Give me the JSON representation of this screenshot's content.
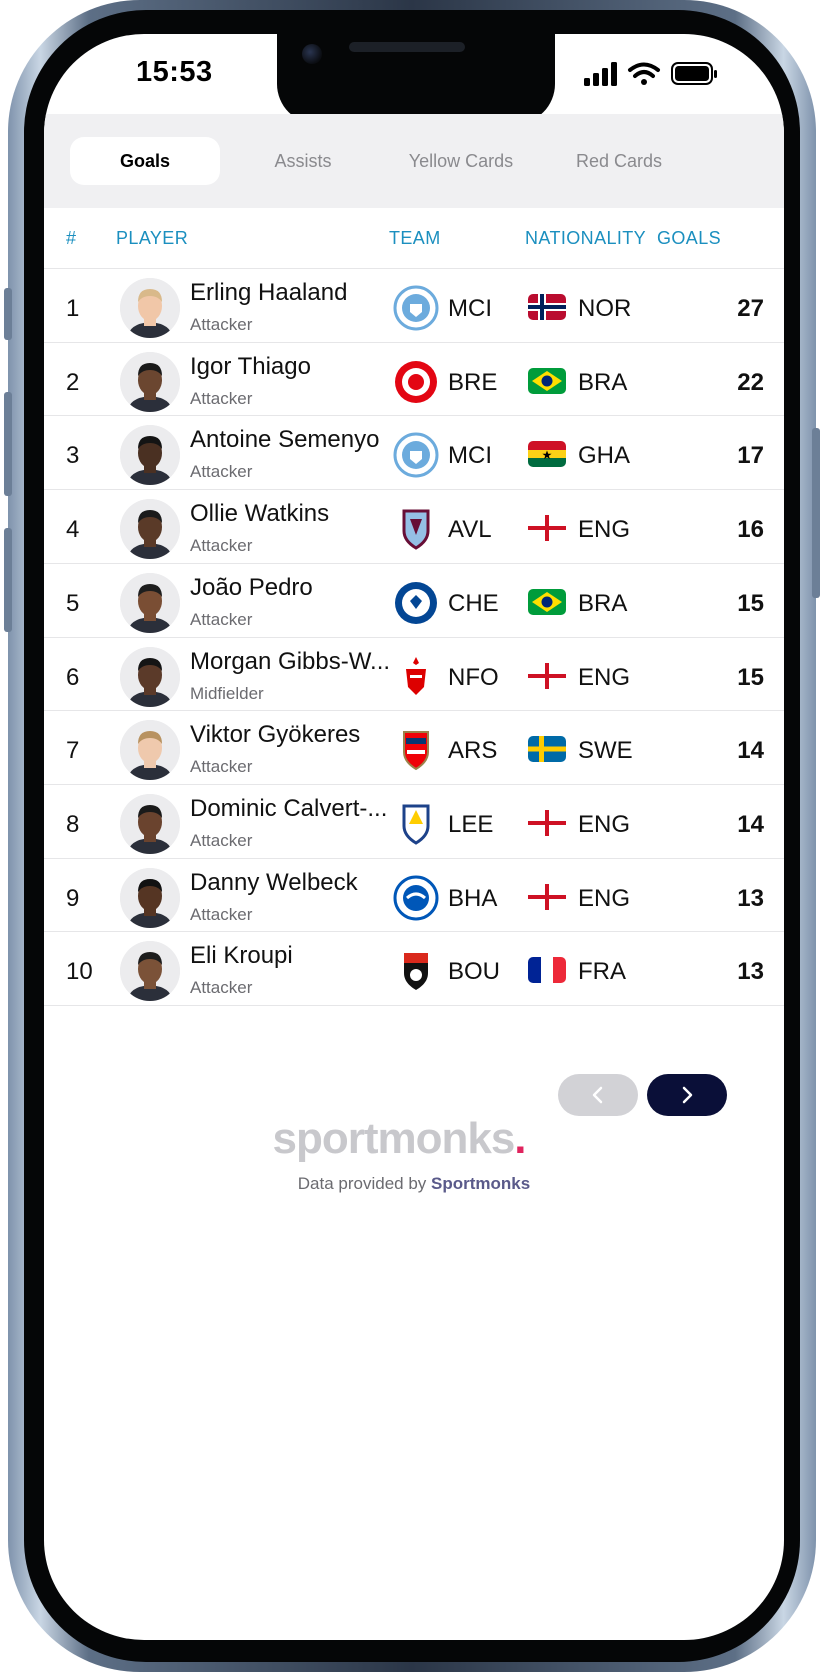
{
  "status_bar": {
    "time": "15:53"
  },
  "tabs": [
    {
      "label": "Goals",
      "active": true
    },
    {
      "label": "Assists",
      "active": false
    },
    {
      "label": "Yellow Cards",
      "active": false
    },
    {
      "label": "Red Cards",
      "active": false
    }
  ],
  "table": {
    "columns": {
      "rank": "#",
      "player": "PLAYER",
      "team": "TEAM",
      "nationality": "NATIONALITY",
      "goals": "GOALS"
    },
    "rows": [
      {
        "rank": "1",
        "name": "Erling Haaland",
        "position": "Attacker",
        "team": "MCI",
        "nationality": "NOR",
        "goals": "27"
      },
      {
        "rank": "2",
        "name": "Igor Thiago",
        "position": "Attacker",
        "team": "BRE",
        "nationality": "BRA",
        "goals": "22"
      },
      {
        "rank": "3",
        "name": "Antoine Semenyo",
        "position": "Attacker",
        "team": "MCI",
        "nationality": "GHA",
        "goals": "17"
      },
      {
        "rank": "4",
        "name": "Ollie Watkins",
        "position": "Attacker",
        "team": "AVL",
        "nationality": "ENG",
        "goals": "16"
      },
      {
        "rank": "5",
        "name": "João Pedro",
        "position": "Attacker",
        "team": "CHE",
        "nationality": "BRA",
        "goals": "15"
      },
      {
        "rank": "6",
        "name": "Morgan Gibbs-W...",
        "position": "Midfielder",
        "team": "NFO",
        "nationality": "ENG",
        "goals": "15"
      },
      {
        "rank": "7",
        "name": "Viktor Gyökeres",
        "position": "Attacker",
        "team": "ARS",
        "nationality": "SWE",
        "goals": "14"
      },
      {
        "rank": "8",
        "name": "Dominic Calvert-...",
        "position": "Attacker",
        "team": "LEE",
        "nationality": "ENG",
        "goals": "14"
      },
      {
        "rank": "9",
        "name": "Danny Welbeck",
        "position": "Attacker",
        "team": "BHA",
        "nationality": "ENG",
        "goals": "13"
      },
      {
        "rank": "10",
        "name": "Eli Kroupi",
        "position": "Attacker",
        "team": "BOU",
        "nationality": "FRA",
        "goals": "13"
      }
    ]
  },
  "pagination": {
    "prev_icon": "chevron-left-icon",
    "next_icon": "chevron-right-icon"
  },
  "footer": {
    "brand": "sportmonks",
    "credit_prefix": "Data provided by",
    "credit_brand": "Sportmonks"
  },
  "colors": {
    "header_accent": "#1b8fbf",
    "next_button": "#0a0f38",
    "brand_dot": "#e0245e"
  }
}
